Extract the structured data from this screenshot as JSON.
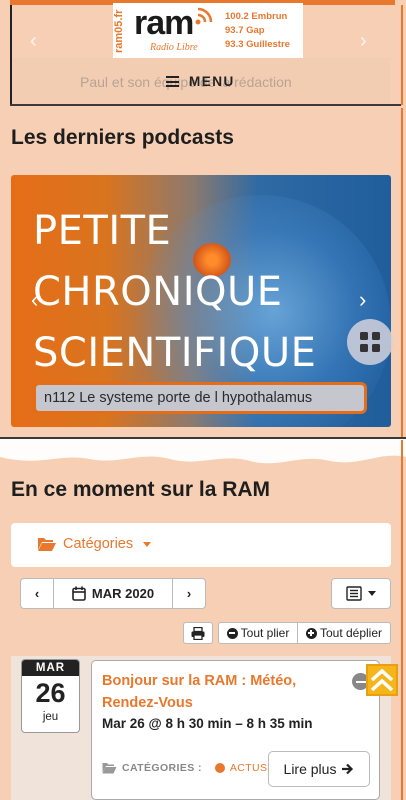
{
  "header": {
    "logo_vertical": "ram05.fr",
    "logo_name": "ram",
    "logo_tagline": "Radio Libre",
    "frequencies": [
      "100.2 Embrun",
      "93.7 Gap",
      "93.3 Guillestre"
    ],
    "ghost_text": "Paul et son équipe de la rédaction",
    "menu_label": "MENU",
    "prev_icon": "chevron-left-icon",
    "next_icon": "chevron-right-icon"
  },
  "podcasts": {
    "title": "Les derniers podcasts",
    "slide_heading": [
      "PETITE",
      "CHRONIQUE",
      "SCIENTIFIQUE"
    ],
    "slide_caption": "n112 Le systeme porte de l hypothalamus"
  },
  "events": {
    "title": "En ce moment sur la RAM",
    "categories_label": "Catégories",
    "current_month": "MAR 2020",
    "fold_all": "Tout plier",
    "unfold_all": "Tout déplier",
    "items": [
      {
        "month": "MAR",
        "day": "26",
        "weekday": "jeu",
        "title": "Bonjour sur la RAM : Météo, Rendez-Vous",
        "time": "Mar 26 @ 8 h 30 min – 8 h 35 min",
        "categories_label": "CATÉGORIES :",
        "category": "ACTUS",
        "read_more": "Lire plus"
      }
    ]
  },
  "colors": {
    "accent": "#e8782e",
    "background": "#f6cfb4",
    "scroll_top": "#f7b51c"
  }
}
